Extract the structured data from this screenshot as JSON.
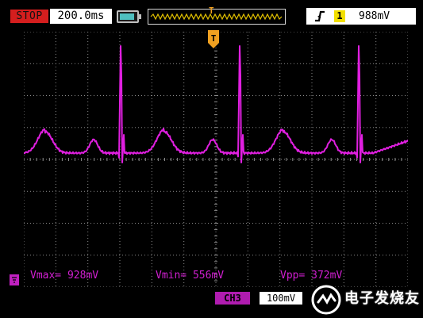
{
  "topbar": {
    "run_state": "STOP",
    "timebase": "200.0ms",
    "trigger_channel": "1",
    "trigger_level": "988mV",
    "trigger_marker": "T",
    "battery_icon": "battery-icon",
    "edge_icon": "rising-edge-icon"
  },
  "screen": {
    "trace_color": "#e01fe0",
    "grid_color": "#8a8a8a",
    "trigger_position_marker": "T",
    "channel_marker_icon": "channel-3-ground-marker-icon"
  },
  "measurements": {
    "vmax": "Vmax= 928mV",
    "vmin": "Vmin= 556mV",
    "vpp": "Vpp= 372mV"
  },
  "bottombar": {
    "channel_label": "CH3",
    "channel_scale": "100mV"
  },
  "watermark": {
    "text": "电子发烧友"
  },
  "colors": {
    "stop_red": "#d41e1e",
    "trigger_orange": "#f0a020",
    "channel1_yellow": "#f3e000",
    "channel3_magenta": "#b01cb0"
  }
}
